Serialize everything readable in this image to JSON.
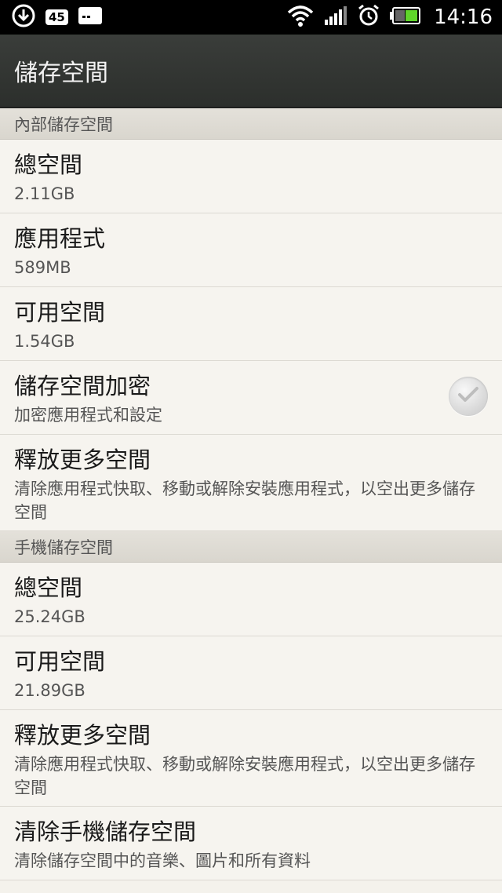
{
  "status_bar": {
    "badge": "45",
    "time": "14:16"
  },
  "title": "儲存空間",
  "sections": [
    {
      "header": "內部儲存空間",
      "items": [
        {
          "title": "總空間",
          "subtitle": "2.11GB"
        },
        {
          "title": "應用程式",
          "subtitle": "589MB"
        },
        {
          "title": "可用空間",
          "subtitle": "1.54GB"
        },
        {
          "title": "儲存空間加密",
          "subtitle": "加密應用程式和設定",
          "checked": false
        },
        {
          "title": "釋放更多空間",
          "subtitle": "清除應用程式快取、移動或解除安裝應用程式，以空出更多儲存空間"
        }
      ]
    },
    {
      "header": "手機儲存空間",
      "items": [
        {
          "title": "總空間",
          "subtitle": "25.24GB"
        },
        {
          "title": "可用空間",
          "subtitle": "21.89GB"
        },
        {
          "title": "釋放更多空間",
          "subtitle": "清除應用程式快取、移動或解除安裝應用程式，以空出更多儲存空間"
        },
        {
          "title": "清除手機儲存空間",
          "subtitle": "清除儲存空間中的音樂、圖片和所有資料"
        }
      ]
    }
  ]
}
